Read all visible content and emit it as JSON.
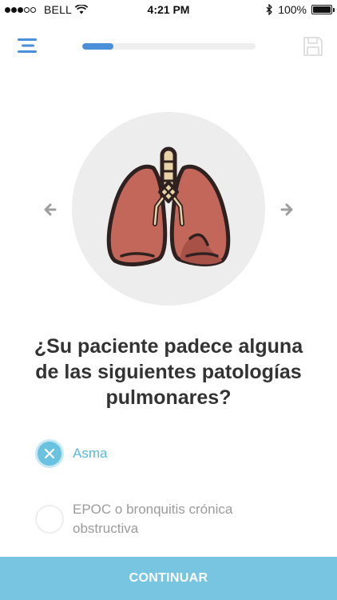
{
  "status_bar": {
    "carrier": "BELL",
    "time": "4:21 PM",
    "battery": "100%",
    "signal_bars_filled": 3,
    "signal_bars_total": 5
  },
  "header": {
    "menu_icon": "hamburger-menu-icon",
    "save_icon": "floppy-disk-icon",
    "progress": 0.18
  },
  "illustration": {
    "icon": "lungs-icon",
    "prev_icon": "arrow-left-icon",
    "next_icon": "arrow-right-icon"
  },
  "question": "¿Su paciente padece alguna de las siguientes patologías pulmonares?",
  "options": [
    {
      "label": "Asma",
      "selected": true
    },
    {
      "label": "EPOC o bronquitis crónica obstructiva",
      "selected": false
    }
  ],
  "continue_label": "CONTINUAR",
  "colors": {
    "accent": "#68c2e0",
    "progress": "#4b8fd8",
    "button": "#78c5e2",
    "lung": "#c2675a"
  }
}
